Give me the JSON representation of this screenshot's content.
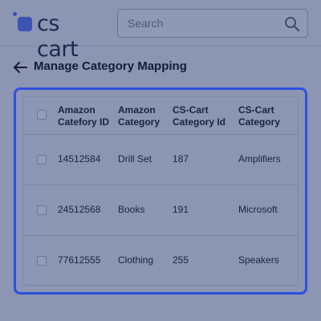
{
  "header": {
    "logo_text": "cs cart",
    "search_placeholder": "Search"
  },
  "page": {
    "title": "Manage Category Mapping"
  },
  "table": {
    "columns": [
      {
        "line1": "Amazon",
        "line2": "Catefory ID"
      },
      {
        "line1": "Amazon",
        "line2": "Category"
      },
      {
        "line1": "CS-Cart",
        "line2": "Category Id"
      },
      {
        "line1": "CS-Cart",
        "line2": "Category"
      }
    ],
    "rows": [
      {
        "amazon_category_id": "14512584",
        "amazon_category": "Drill Set",
        "cscart_category_id": "187",
        "cscart_category": "Amplifiers"
      },
      {
        "amazon_category_id": "24512568",
        "amazon_category": "Books",
        "cscart_category_id": "191",
        "cscart_category": "Microsoft"
      },
      {
        "amazon_category_id": "77612555",
        "amazon_category": "Clothing",
        "cscart_category_id": "255",
        "cscart_category": "Speakers"
      }
    ]
  },
  "colors": {
    "background": "#8c95b1",
    "accent_border": "#2d4fe0",
    "logo_blue": "#3d54b4",
    "text_dark": "#131c38"
  },
  "icons": {
    "search": "search-icon",
    "back": "back-arrow-icon",
    "logo": "logo-icon"
  }
}
